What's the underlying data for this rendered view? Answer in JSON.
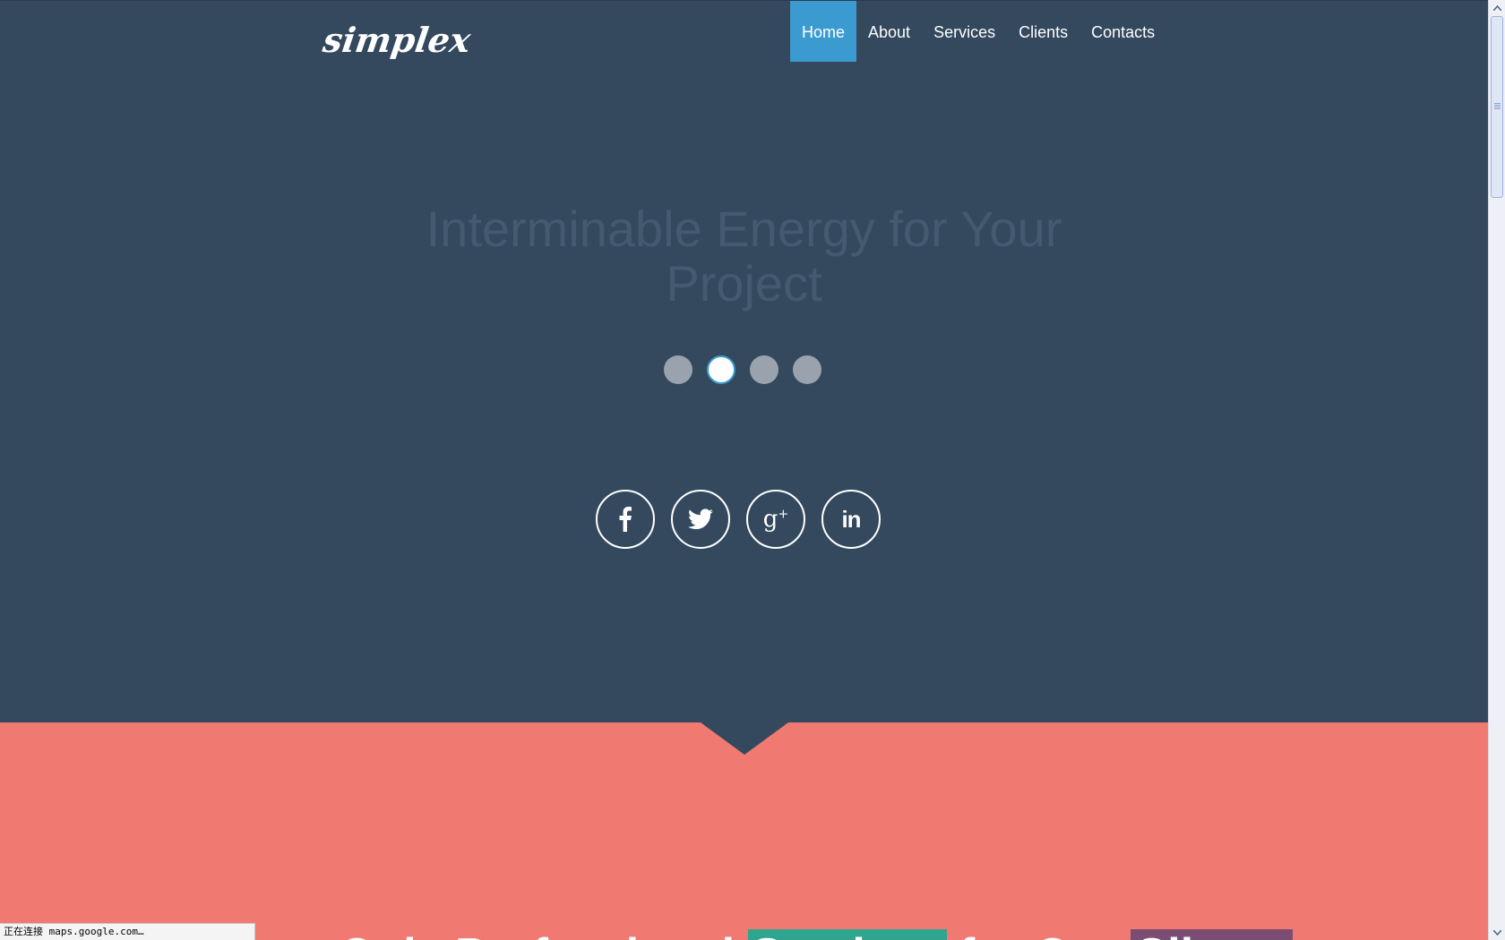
{
  "brand": {
    "logo_text": "simplex"
  },
  "nav": {
    "items": [
      {
        "label": "Home",
        "active": true
      },
      {
        "label": "About",
        "active": false
      },
      {
        "label": "Services",
        "active": false
      },
      {
        "label": "Clients",
        "active": false
      },
      {
        "label": "Contacts",
        "active": false
      }
    ]
  },
  "hero": {
    "title_line1": "Interminable Energy for Your",
    "title_line2": "Project",
    "slider": {
      "count": 4,
      "active_index": 1
    },
    "social": [
      {
        "icon": "facebook-icon",
        "glyph": "f"
      },
      {
        "icon": "twitter-icon",
        "glyph": "bird"
      },
      {
        "icon": "google-plus-icon",
        "glyph": "g+"
      },
      {
        "icon": "linkedin-icon",
        "glyph": "in"
      }
    ]
  },
  "section2": {
    "title_prefix": "Only Professional",
    "title_hl1": "Services",
    "title_mid": "for Our",
    "title_hl2": "Clients"
  },
  "status_bar": {
    "text": "正在连接 maps.google.com…"
  },
  "colors": {
    "hero_bg": "#34495e",
    "accent_blue": "#3b9bd0",
    "salmon": "#f07a71",
    "highlight_green": "#2ea58e",
    "highlight_purple": "#7b4d73"
  }
}
